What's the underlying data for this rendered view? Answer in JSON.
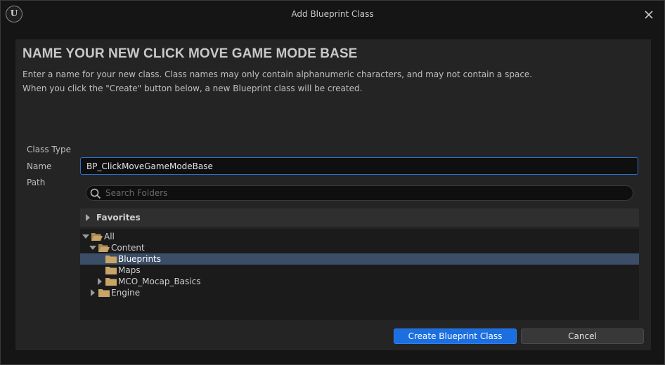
{
  "window": {
    "title": "Add Blueprint Class",
    "logo_text": "U"
  },
  "main": {
    "heading": "NAME YOUR NEW CLICK MOVE GAME MODE BASE",
    "description_line1": "Enter a name for your new class. Class names may only contain alphanumeric characters, and may not contain a space.",
    "description_line2": "When you click the \"Create\" button below, a new Blueprint class will be created."
  },
  "form": {
    "class_type_label": "Class Type",
    "name_label": "Name",
    "path_label": "Path",
    "name_value": "BP_ClickMoveGameModeBase",
    "search_placeholder": "Search Folders"
  },
  "favorites": {
    "label": "Favorites"
  },
  "tree": [
    {
      "label": "All",
      "expanded": true,
      "selected": false
    },
    {
      "label": "Content",
      "expanded": true,
      "selected": false
    },
    {
      "label": "Blueprints",
      "selected": true
    },
    {
      "label": "Maps",
      "selected": false
    },
    {
      "label": "MCO_Mocap_Basics",
      "expanded": false,
      "selected": false
    },
    {
      "label": "Engine",
      "expanded": false,
      "selected": false
    }
  ],
  "buttons": {
    "create": "Create Blueprint Class",
    "cancel": "Cancel"
  },
  "colors": {
    "accent": "#1b6fe0",
    "selection": "#3c4e67",
    "folder": "#c9a468",
    "input_border": "#2a6fd0"
  }
}
